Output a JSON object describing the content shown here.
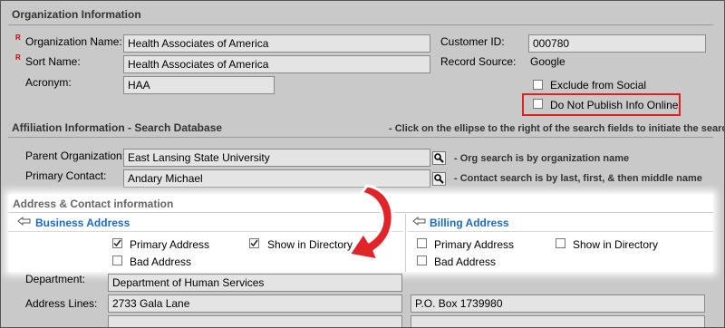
{
  "org_section": {
    "title": "Organization Information",
    "required_marker": "R",
    "org_name_label": "Organization Name:",
    "org_name_value": "Health Associates of America",
    "sort_name_label": "Sort Name:",
    "sort_name_value": "Health Associates of America",
    "acronym_label": "Acronym:",
    "acronym_value": "HAA",
    "customer_id_label": "Customer ID:",
    "customer_id_value": "000780",
    "record_source_label": "Record Source:",
    "record_source_value": "Google",
    "exclude_social_label": "Exclude from Social",
    "do_not_publish_label": "Do Not Publish Info Online"
  },
  "affiliation_section": {
    "title": "Affiliation Information - Search Database",
    "hint": "- Click on the ellipse to the right of the search fields to initiate the search",
    "parent_org_label": "Parent Organization:",
    "parent_org_value": "East Lansing State University",
    "parent_org_note": "- Org search is by organization name",
    "primary_contact_label": "Primary Contact:",
    "primary_contact_value": "Andary Michael",
    "primary_contact_note": "- Contact search is by last, first, & then middle name"
  },
  "address_section": {
    "title": "Address & Contact information",
    "business": {
      "title": "Business Address",
      "primary_label": "Primary Address",
      "primary_checked": true,
      "directory_label": "Show in Directory",
      "directory_checked": true,
      "bad_label": "Bad Address",
      "bad_checked": false
    },
    "billing": {
      "title": "Billing Address",
      "primary_label": "Primary Address",
      "primary_checked": false,
      "directory_label": "Show in Directory",
      "directory_checked": false,
      "bad_label": "Bad Address",
      "bad_checked": false
    }
  },
  "details": {
    "department_label": "Department:",
    "department_value": "Department of Human Services",
    "address_lines_label": "Address Lines:",
    "business_address_line1": "2733 Gala Lane",
    "billing_address_line1": "P.O. Box 1739980"
  },
  "colors": {
    "background": "#c9c9c9",
    "highlight_border": "#e02020",
    "link_blue": "#1e6bbd",
    "arrow_fill": "#e0242a"
  }
}
